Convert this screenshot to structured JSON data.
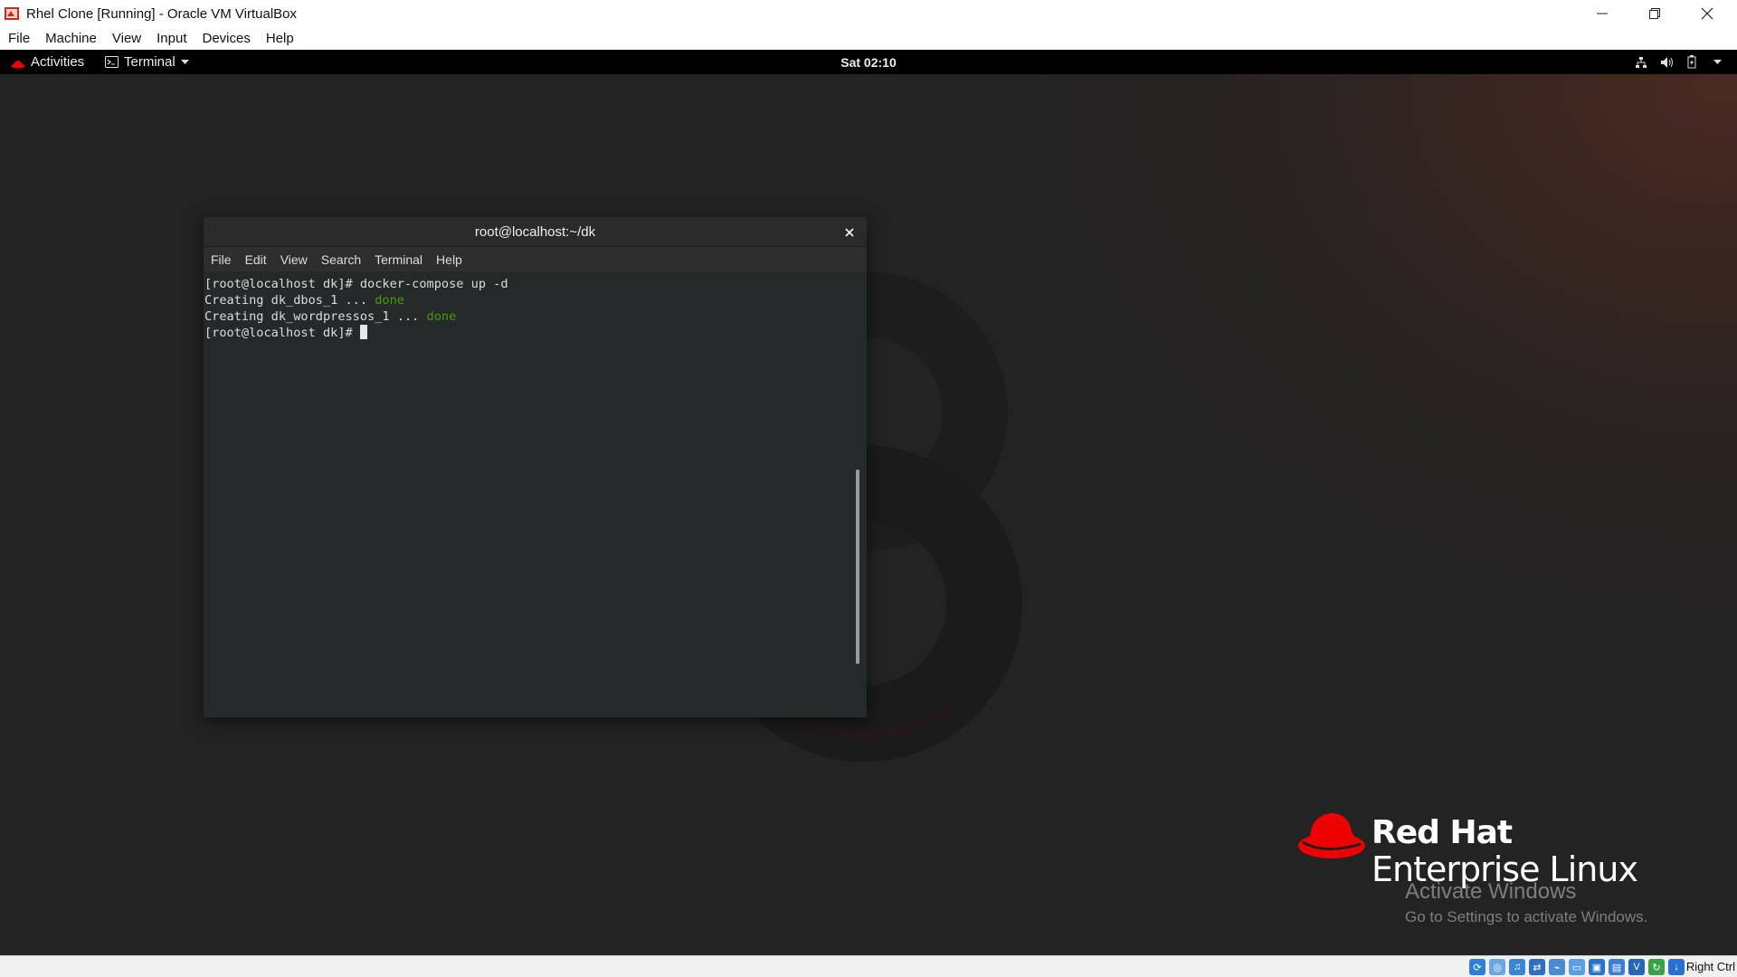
{
  "host": {
    "title": "Rhel Clone [Running] - Oracle VM VirtualBox",
    "menu": [
      "File",
      "Machine",
      "View",
      "Input",
      "Devices",
      "Help"
    ],
    "host_key": "Right Ctrl"
  },
  "gnome": {
    "activities": "Activities",
    "app_menu": "Terminal",
    "clock": "Sat 02:10"
  },
  "terminal": {
    "title": "root@localhost:~/dk",
    "menu": [
      "File",
      "Edit",
      "View",
      "Search",
      "Terminal",
      "Help"
    ],
    "lines": [
      {
        "text": "[root@localhost dk]# docker-compose up -d",
        "status": ""
      },
      {
        "text": "Creating dk_dbos_1 ... ",
        "status": "done"
      },
      {
        "text": "Creating dk_wordpressos_1 ... ",
        "status": "done"
      },
      {
        "text": "[root@localhost dk]# ",
        "status": ""
      }
    ]
  },
  "branding": {
    "name": "Red Hat",
    "product": "Enterprise Linux"
  },
  "watermark": {
    "title": "Activate Windows",
    "subtitle": "Go to Settings to activate Windows."
  },
  "colors": {
    "terminal_bg": "#242a2a",
    "done_green": "#4e9a06",
    "redhat_red": "#ee0000"
  }
}
